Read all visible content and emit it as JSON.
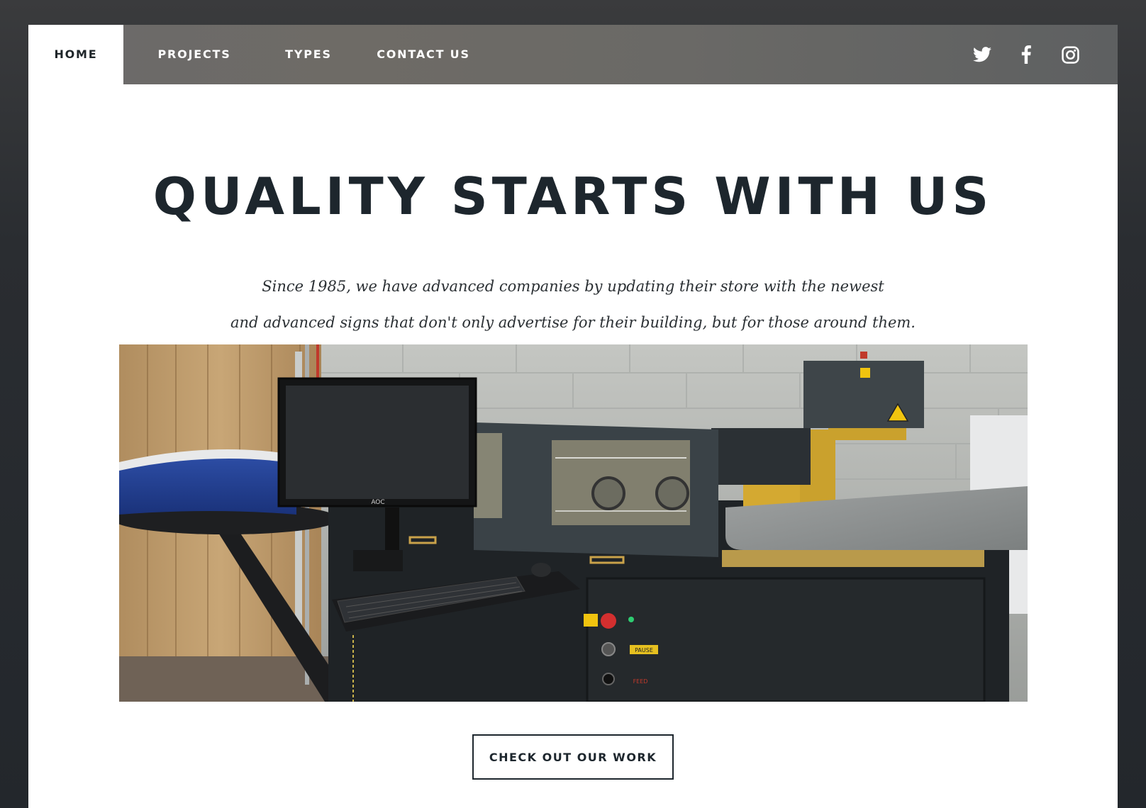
{
  "nav": {
    "items": [
      {
        "label": "HOME",
        "active": true
      },
      {
        "label": "PROJECTS",
        "active": false
      },
      {
        "label": "TYPES",
        "active": false
      },
      {
        "label": "CONTACT US",
        "active": false
      }
    ],
    "social_icons": [
      "twitter-icon",
      "facebook-icon",
      "instagram-icon"
    ]
  },
  "hero": {
    "headline": "QUALITY STARTS WITH US",
    "intro_line1": "Since 1985, we have advanced companies by updating their store with the newest",
    "intro_line2": "and advanced signs that don't only advertise for their building, but for those around them.",
    "photo": {
      "monitor_brand": "AOC",
      "pause_label": "PAUSE",
      "feed_label": "FEED"
    },
    "cta_label": "CHECK OUT OUR WORK"
  },
  "colors": {
    "text_dark": "#1d262d",
    "nav_bg": "#6b6a6a",
    "page_bg": "#2a2d31",
    "card_bg": "#ffffff"
  }
}
